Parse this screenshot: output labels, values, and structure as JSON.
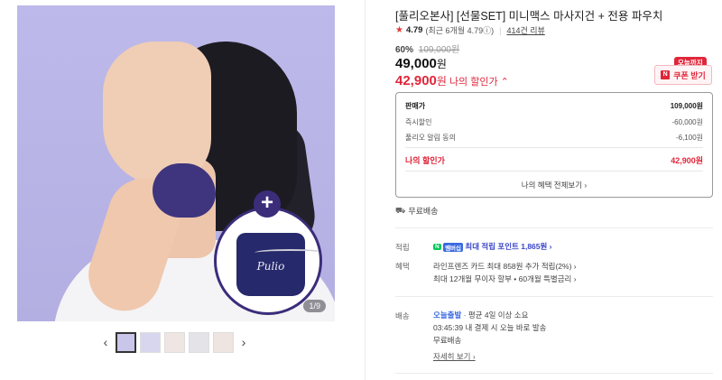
{
  "gallery": {
    "pouch_brand": "Pulio",
    "counter": "1/9"
  },
  "thumbs": {
    "prev": "‹",
    "next": "›"
  },
  "product": {
    "title": "[풀리오본사] [선물SET] 미니맥스 마사지건 + 전용 파우치",
    "rating": "4.79",
    "rating_detail": "(최근 6개월 4.79ⓘ)",
    "reviews": "414건 리뷰",
    "discount_pct": "60%",
    "original_price": "109,000원",
    "sale_price": "49,000",
    "my_price": "42,900",
    "price_unit": "원",
    "my_price_label": "나의 할인가 ⌃",
    "today_badge": "오늘까지",
    "coupon_label": "쿠폰 받기",
    "coupon_icon_glyph": "N"
  },
  "price_box": {
    "rows": [
      {
        "label": "판매가",
        "value": "109,000원"
      },
      {
        "label": "즉시할인",
        "value": "-60,000원"
      },
      {
        "label": "풀리오 알림 동의",
        "value": "-6,100원"
      },
      {
        "label": "나의 할인가",
        "value": "42,900원"
      }
    ],
    "more": "나의 혜택 전체보기 ›"
  },
  "shipping": {
    "icon": "⛟",
    "text": "무료배송"
  },
  "points": {
    "label": "적립",
    "npay": "N",
    "membership": "멤버십",
    "text": "최대 적립 포인트 1,865원 ›"
  },
  "benefits": {
    "label": "혜택",
    "line1": "라인프렌즈 카드 최대 858원 추가 적립(2%) ›",
    "line2": "최대 12개월 무이자 할부 • 60개월 특별금리 ›"
  },
  "delivery": {
    "label": "배송",
    "type": "오늘출발",
    "avg": "· 평균 4일 이상 소요",
    "cutoff": "03:45:39  내 결제 시 오늘 바로 발송",
    "fee": "무료배송",
    "detail": "자세히 보기 ›"
  },
  "colors": {
    "accent_red": "#e0263a",
    "brand_purple": "#3b2d7a",
    "point_blue": "#3a45c8"
  }
}
